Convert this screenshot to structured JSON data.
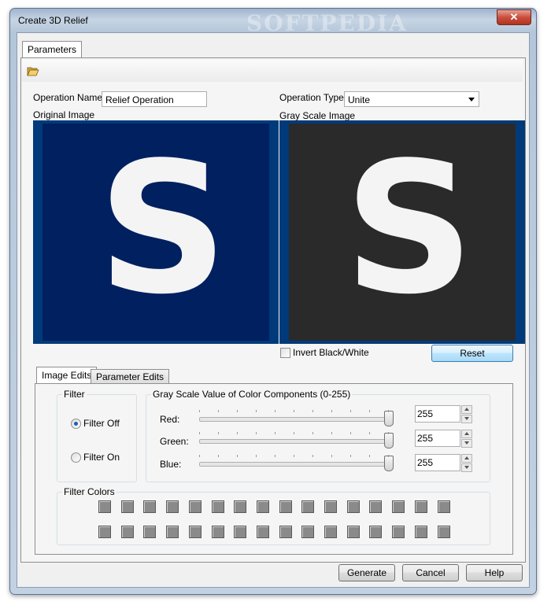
{
  "window": {
    "title": "Create 3D Relief",
    "watermark": "SOFTPEDIA",
    "close_glyph": "✕"
  },
  "tabs_top": [
    {
      "label": "Parameters"
    }
  ],
  "toolbar": {
    "open_icon": "folder-open-icon"
  },
  "operation": {
    "name_label": "Operation Name:",
    "name_value": "Relief Operation",
    "type_label": "Operation Type:",
    "type_value": "Unite"
  },
  "images": {
    "original_label": "Original Image",
    "grayscale_label": "Gray Scale Image",
    "original_glyph": "S",
    "grayscale_glyph": "S",
    "original_bg": "#003a7a",
    "original_inner": "#002060",
    "grayscale_inner": "#2a2a2a"
  },
  "invert": {
    "label": "Invert Black/White",
    "checked": false
  },
  "reset_label": "Reset",
  "edit_tabs": [
    {
      "label": "Image Edits"
    },
    {
      "label": "Parameter Edits"
    }
  ],
  "filter": {
    "title": "Filter",
    "options": [
      {
        "label": "Filter Off",
        "selected": true
      },
      {
        "label": "Filter On",
        "selected": false
      }
    ]
  },
  "gray_scale": {
    "title": "Gray Scale Value of Color Components (0-255)",
    "components": [
      {
        "label": "Red:",
        "value": "255"
      },
      {
        "label": "Green:",
        "value": "255"
      },
      {
        "label": "Blue:",
        "value": "255"
      }
    ]
  },
  "filter_colors": {
    "title": "Filter Colors",
    "swatch_color": "#8a8a8a"
  },
  "buttons": {
    "generate": "Generate",
    "cancel": "Cancel",
    "help": "Help"
  }
}
